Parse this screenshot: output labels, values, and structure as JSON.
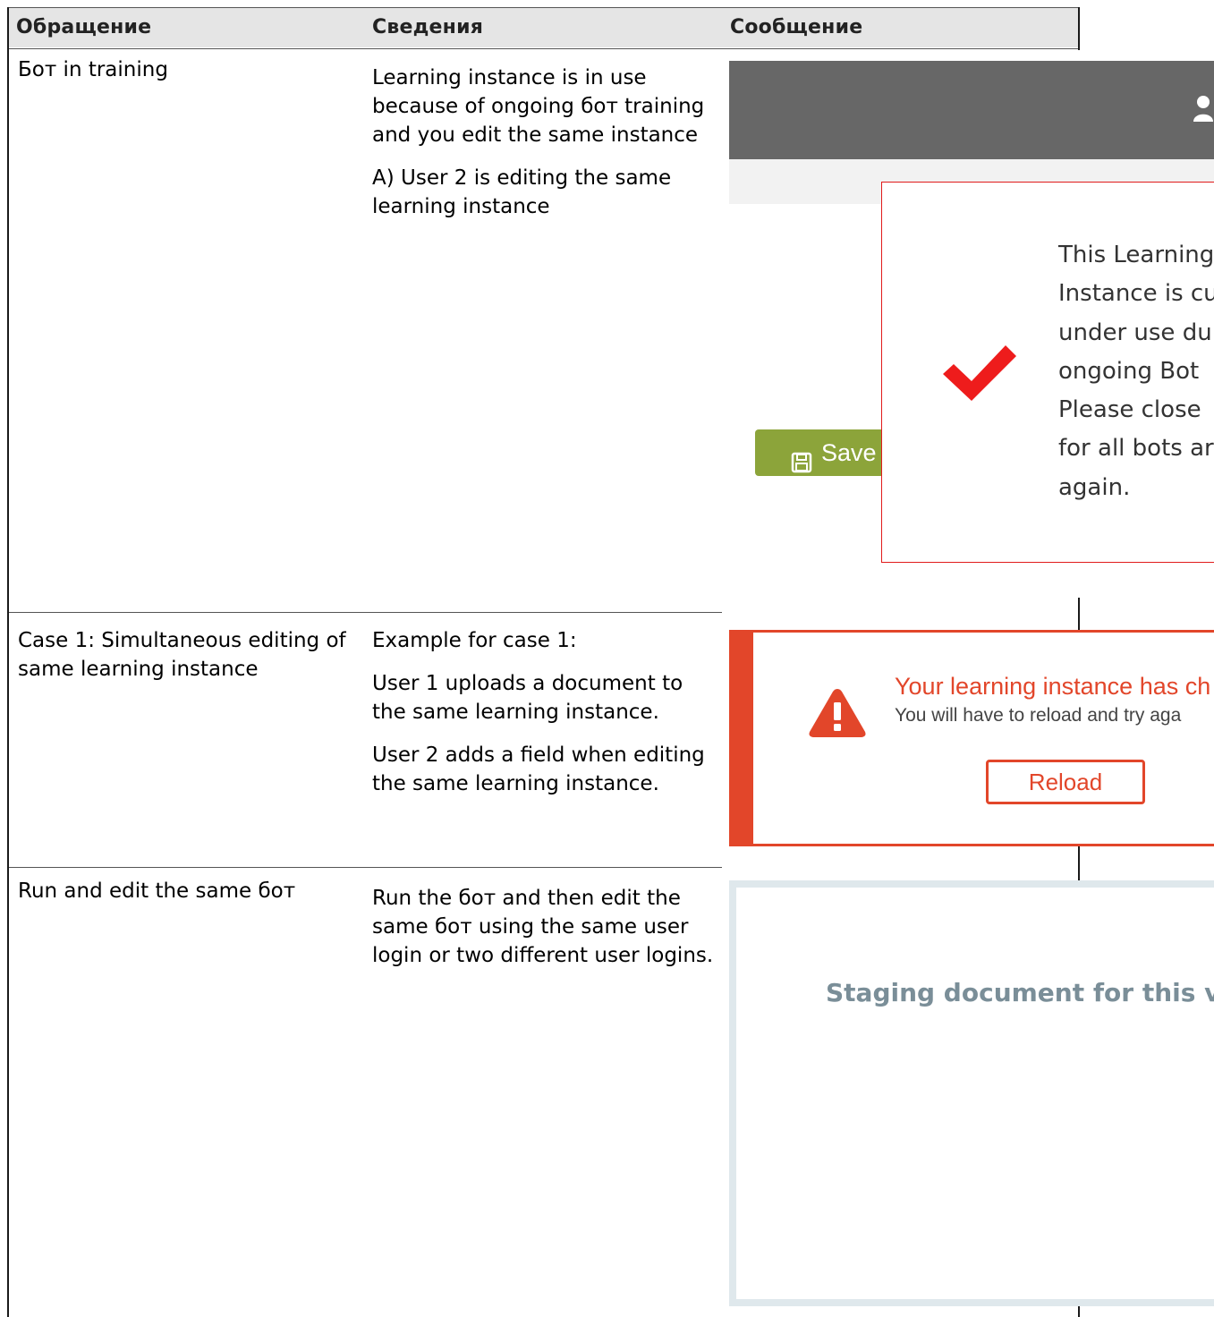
{
  "table": {
    "headers": {
      "col1": "Обращение",
      "col2": "Сведения",
      "col3": "Сообщение"
    },
    "rows": [
      {
        "issue": "Бот in training",
        "details": [
          "Learning instance is in use because of ongoing бот training and you edit the same instance",
          "A) User 2 is editing the same learning instance"
        ]
      },
      {
        "issue": "Case 1: Simultaneous editing of same learning instance",
        "details": [
          "Example for case 1:",
          "User 1 uploads a document to the same learning instance.",
          "User 2 adds a field when editing the same learning instance."
        ]
      },
      {
        "issue": "Run and edit the same бот",
        "details": [
          "Run the бот and then edit the same бот using the same user login or two different user logins."
        ]
      }
    ]
  },
  "screens": {
    "training": {
      "save_label": "Save",
      "dialog_lines": [
        "This Learning",
        "Instance is cu",
        "under use du",
        "ongoing Bot",
        "Please close",
        "for all bots ar",
        "again."
      ],
      "icons": [
        "user-icon",
        "floppy-icon",
        "checkmark-icon"
      ],
      "colors": {
        "dialog_border": "#e11b1b",
        "save_button": "#8ca43a",
        "topbar": "#676767"
      }
    },
    "concurrent_edit": {
      "title": "Your learning instance has ch",
      "subtitle": "You will have to reload and try aga",
      "reload_label": "Reload",
      "icons": [
        "warning-icon"
      ],
      "colors": {
        "accent": "#e2462a"
      }
    },
    "run_edit": {
      "text": "Staging document for this vis",
      "colors": {
        "frame": "#dfe8ec",
        "text": "#7a8e98"
      }
    }
  }
}
